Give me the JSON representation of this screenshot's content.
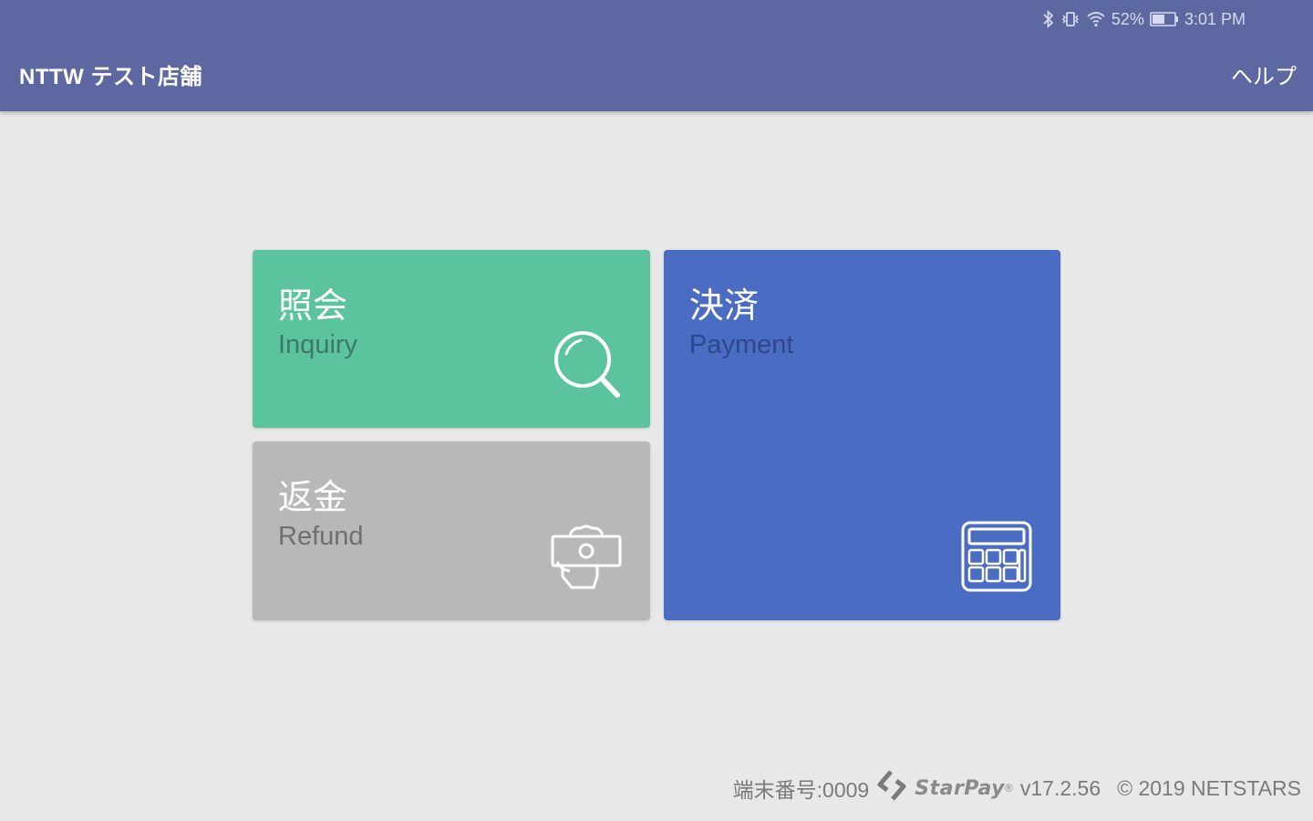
{
  "status_bar": {
    "battery": "52%",
    "time": "3:01 PM",
    "icons": [
      "bluetooth-icon",
      "vibrate-icon",
      "wifi-icon",
      "battery-icon"
    ]
  },
  "header": {
    "store_name": "NTTW テスト店舗",
    "help_label": "ヘルプ"
  },
  "tiles": {
    "inquiry": {
      "title": "照会",
      "subtitle": "Inquiry",
      "icon": "search-icon"
    },
    "refund": {
      "title": "返金",
      "subtitle": "Refund",
      "icon": "refund-cash-icon"
    },
    "payment": {
      "title": "決済",
      "subtitle": "Payment",
      "icon": "calculator-icon"
    }
  },
  "footer": {
    "terminal": "端末番号:0009",
    "brand": "StarPay",
    "registered": "®",
    "version": "v17.2.56",
    "copyright": "© 2019 NETSTARS"
  },
  "colors": {
    "appbar": "#5e68a0",
    "background": "#e8e8e8",
    "inquiry": "#5bc49c",
    "refund": "#b8b8b8",
    "payment": "#4a6cc2"
  }
}
